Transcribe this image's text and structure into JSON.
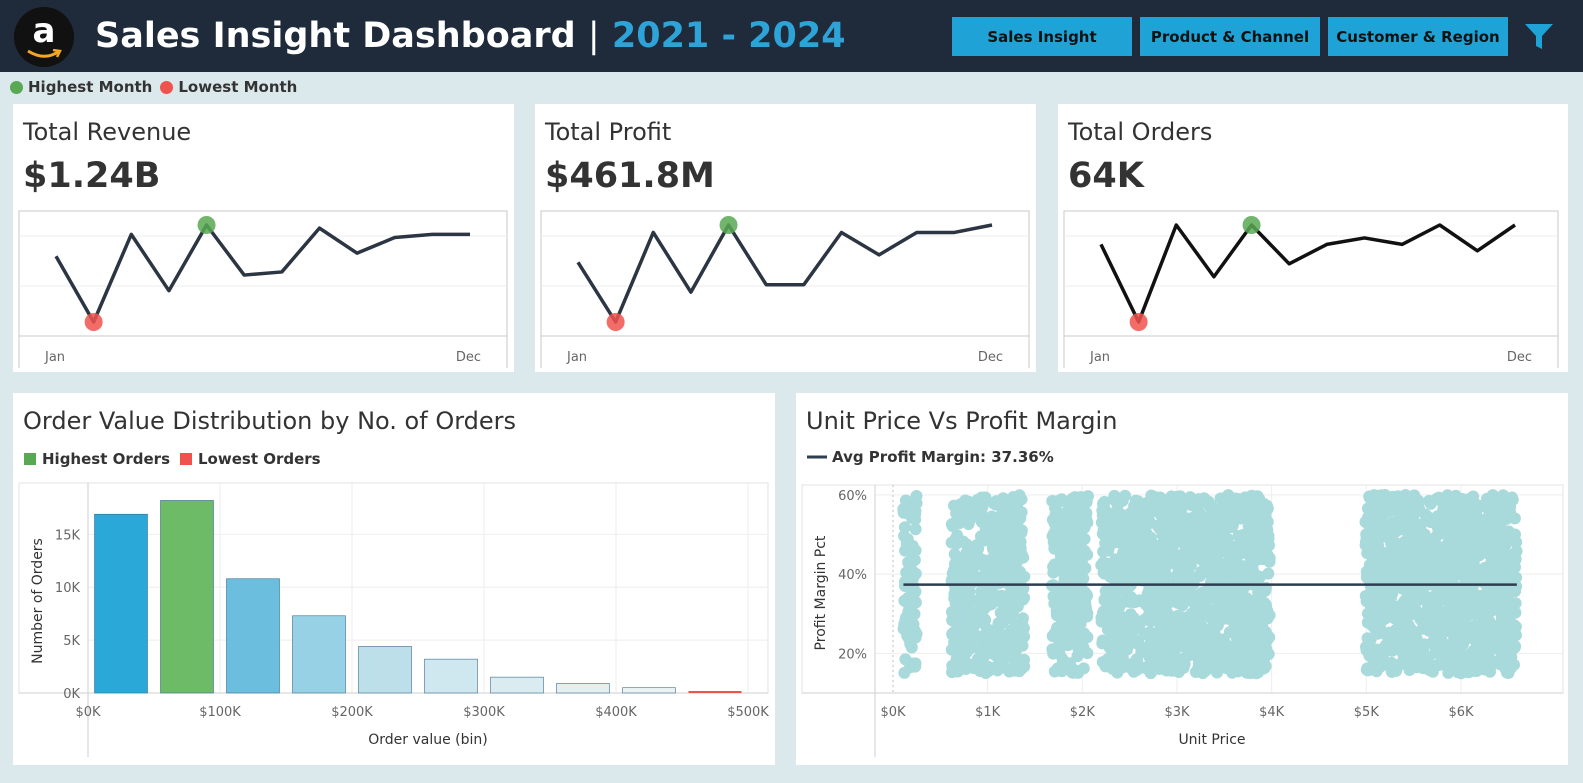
{
  "header": {
    "logo_letter": "a",
    "title": "Sales Insight Dashboard",
    "separator": "|",
    "years": "2021 - 2024",
    "nav": [
      "Sales Insight",
      "Product & Channel",
      "Customer & Region"
    ]
  },
  "legend": {
    "highest": "Highest Month",
    "lowest": "Lowest Month",
    "high_color": "#59a852",
    "low_color": "#f0524d"
  },
  "kpis": [
    {
      "label": "Total Revenue",
      "value": "$1.24B",
      "x_start": "Jan",
      "x_end": "Dec",
      "months": [
        1,
        2,
        3,
        4,
        5,
        6,
        7,
        8,
        9,
        10,
        11,
        12
      ],
      "series": [
        95,
        74,
        102,
        84,
        105,
        89,
        90,
        104,
        96,
        101,
        102,
        102
      ],
      "high": 5,
      "low": 2
    },
    {
      "label": "Total Profit",
      "value": "$461.8M",
      "x_start": "Jan",
      "x_end": "Dec",
      "months": [
        1,
        2,
        3,
        4,
        5,
        6,
        7,
        8,
        9,
        10,
        11,
        12
      ],
      "series": [
        35,
        27,
        39,
        31,
        40,
        32,
        32,
        39,
        36,
        39,
        39,
        40
      ],
      "high": 5,
      "low": 2
    },
    {
      "label": "Total Orders",
      "value": "64K",
      "x_start": "Jan",
      "x_end": "Dec",
      "months": [
        1,
        2,
        3,
        4,
        5,
        6,
        7,
        8,
        9,
        10,
        11,
        12
      ],
      "series": [
        5.4,
        4.2,
        5.7,
        4.9,
        5.7,
        5.1,
        5.4,
        5.5,
        5.4,
        5.7,
        5.3,
        5.7
      ],
      "high": 5,
      "low": 2
    }
  ],
  "hist": {
    "title": "Order Value Distribution by No. of Orders",
    "legend_high": "Highest Orders",
    "legend_low": "Lowest Orders",
    "ylabel": "Number of Orders",
    "xlabel": "Order value (bin)"
  },
  "scatter": {
    "title": "Unit Price Vs Profit Margin",
    "legend": "Avg Profit Margin: 37.36%",
    "ylabel": "Profit Margin Pct",
    "xlabel": "Unit Price"
  },
  "chart_data": [
    {
      "type": "bar",
      "title": "Order Value Distribution by No. of Orders",
      "xlabel": "Order value (bin)",
      "ylabel": "Number of Orders",
      "bin_starts": [
        0,
        50000,
        100000,
        150000,
        200000,
        250000,
        300000,
        350000,
        400000,
        450000
      ],
      "values": [
        16900,
        18200,
        10800,
        7300,
        4400,
        3200,
        1500,
        900,
        500,
        150
      ],
      "highlight": {
        "highest": 1,
        "lowest": 9
      },
      "xticks": [
        "$0K",
        "$100K",
        "$200K",
        "$300K",
        "$400K",
        "$500K"
      ],
      "yticks": [
        "0K",
        "5K",
        "10K",
        "15K"
      ],
      "ylim": [
        0,
        19000
      ],
      "colors": [
        "#2aa8d8",
        "#6dba67",
        "#6cbede",
        "#97d1e5",
        "#bddfea",
        "#cfe7ee",
        "#dbecf1",
        "#e4eff2",
        "#eaf2f4",
        "#f0524d"
      ]
    },
    {
      "type": "scatter",
      "title": "Unit Price Vs Profit Margin",
      "xlabel": "Unit Price",
      "ylabel": "Profit Margin Pct",
      "xlim": [
        0,
        6900
      ],
      "ylim": [
        10,
        62
      ],
      "xticks": [
        "$0K",
        "$1K",
        "$2K",
        "$3K",
        "$4K",
        "$5K",
        "$6K"
      ],
      "yticks": [
        "20%",
        "40%",
        "60%"
      ],
      "avg_line": 37.36,
      "price_ranges": [
        [
          110,
          250
        ],
        [
          620,
          1390
        ],
        [
          1680,
          2060
        ],
        [
          2200,
          3980
        ],
        [
          4990,
          6590
        ]
      ],
      "margin_range": [
        15,
        60
      ],
      "color": "#a8dadc"
    }
  ]
}
